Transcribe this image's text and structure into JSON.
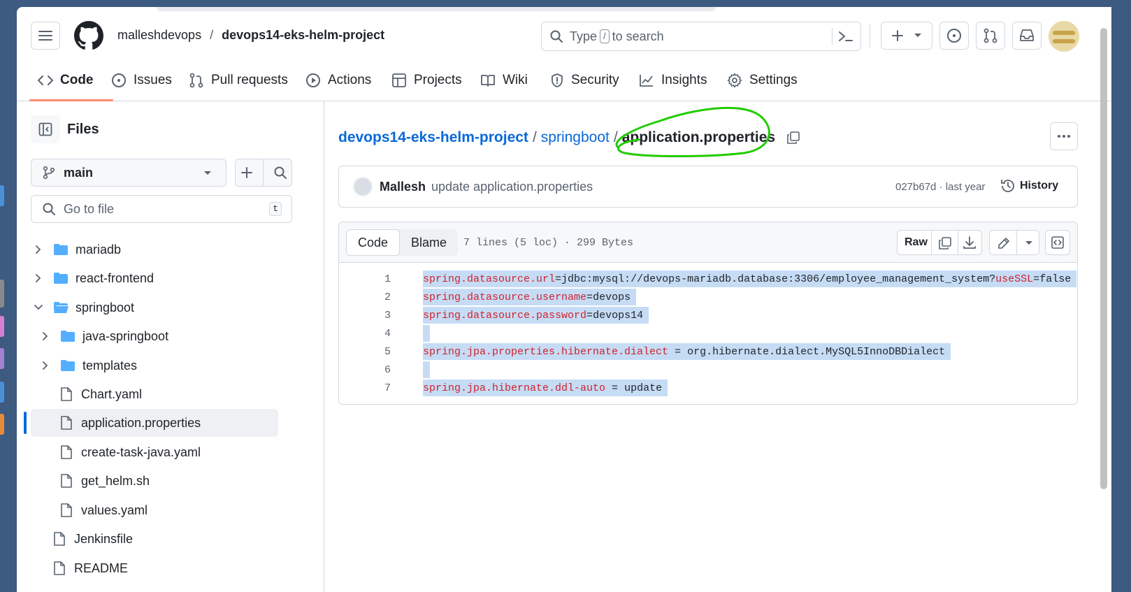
{
  "header": {
    "owner": "malleshdevops",
    "separator": "/",
    "repo": "devops14-eks-helm-project",
    "search_prefix": "Type",
    "search_key": "/",
    "search_suffix": "to search"
  },
  "tabs": [
    {
      "label": "Code"
    },
    {
      "label": "Issues"
    },
    {
      "label": "Pull requests"
    },
    {
      "label": "Actions"
    },
    {
      "label": "Projects"
    },
    {
      "label": "Wiki"
    },
    {
      "label": "Security"
    },
    {
      "label": "Insights"
    },
    {
      "label": "Settings"
    }
  ],
  "sidebar": {
    "title": "Files",
    "branch": "main",
    "goto_placeholder": "Go to file",
    "goto_key": "t",
    "items": [
      {
        "label": "mariadb",
        "type": "folder"
      },
      {
        "label": "react-frontend",
        "type": "folder"
      },
      {
        "label": "springboot",
        "type": "folder-open"
      },
      {
        "label": "java-springboot",
        "type": "folder"
      },
      {
        "label": "templates",
        "type": "folder"
      },
      {
        "label": "Chart.yaml",
        "type": "file"
      },
      {
        "label": "application.properties",
        "type": "file"
      },
      {
        "label": "create-task-java.yaml",
        "type": "file"
      },
      {
        "label": "get_helm.sh",
        "type": "file"
      },
      {
        "label": "values.yaml",
        "type": "file"
      },
      {
        "label": "Jenkinsfile",
        "type": "file"
      },
      {
        "label": "README",
        "type": "file"
      }
    ]
  },
  "breadcrumb": {
    "repo": "devops14-eks-helm-project",
    "folder": "springboot",
    "file": "application.properties",
    "sep": "/"
  },
  "commit": {
    "author": "Mallesh",
    "message": "update application.properties",
    "meta": "027b67d · last year",
    "history": "History"
  },
  "code_view": {
    "tab_code": "Code",
    "tab_blame": "Blame",
    "info": "7 lines (5 loc) · 299 Bytes",
    "raw": "Raw",
    "lines": [
      {
        "num": "1",
        "key": "spring.datasource.url",
        "op": "=",
        "value": "jdbc:mysql://devops-mariadb.database:3306/employee_management_system?",
        "key2": "useSSL",
        "op2": "=",
        "value2": "false"
      },
      {
        "num": "2",
        "key": "spring.datasource.username",
        "op": "=",
        "value": "devops",
        "key2": "",
        "op2": "",
        "value2": ""
      },
      {
        "num": "3",
        "key": "spring.datasource.password",
        "op": "=",
        "value": "devops14",
        "key2": "",
        "op2": "",
        "value2": ""
      },
      {
        "num": "4",
        "key": "",
        "op": "",
        "value": "",
        "key2": "",
        "op2": "",
        "value2": ""
      },
      {
        "num": "5",
        "key": "spring.jpa.properties.hibernate.dialect",
        "op": " = ",
        "value": "org.hibernate.dialect.MySQL5InnoDBDialect",
        "key2": "",
        "op2": "",
        "value2": ""
      },
      {
        "num": "6",
        "key": "",
        "op": "",
        "value": "",
        "key2": "",
        "op2": "",
        "value2": ""
      },
      {
        "num": "7",
        "key": "spring.jpa.hibernate.ddl-auto",
        "op": " = ",
        "value": "update",
        "key2": "",
        "op2": "",
        "value2": ""
      }
    ]
  },
  "colors": {
    "accent_link": "#0969da",
    "tab_underline": "#fd8c73",
    "selection": "#c6dcf5",
    "annotation": "#22cc00"
  }
}
